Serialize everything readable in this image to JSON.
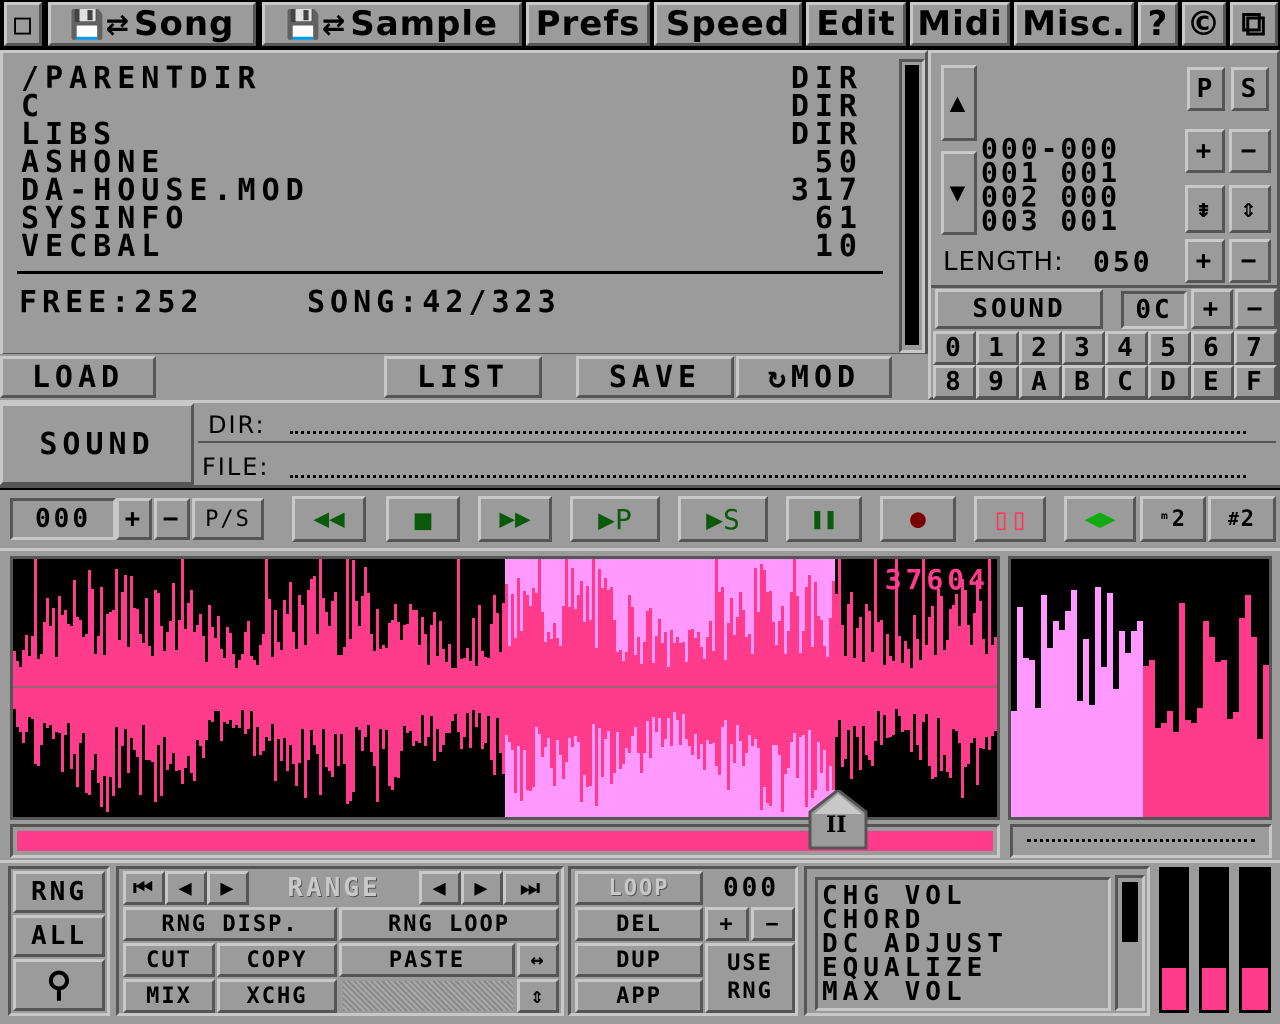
{
  "menu": {
    "close_glyph": "▫",
    "song_label": "Song",
    "sample_label": "Sample",
    "prefs_label": "Prefs",
    "speed_label": "Speed",
    "edit_label": "Edit",
    "midi_label": "Midi",
    "misc_label": "Misc.",
    "help_label": "?",
    "about_label": "©",
    "window_glyph": "⧉"
  },
  "file_browser": {
    "rows": [
      {
        "name": "/PARENTDIR",
        "size": "DIR"
      },
      {
        "name": "C",
        "size": "DIR"
      },
      {
        "name": "LIBS",
        "size": "DIR"
      },
      {
        "name": "ASHONE",
        "size": "50"
      },
      {
        "name": "DA-HOUSE.MOD",
        "size": "317"
      },
      {
        "name": "SYSINFO",
        "size": "61"
      },
      {
        "name": "VECBAL",
        "size": "10"
      }
    ],
    "free_label": "FREE:252",
    "song_label": "SONG:42/323"
  },
  "file_buttons": {
    "load": "LOAD",
    "list": "LIST",
    "save": "SAVE",
    "mod": "↻MOD"
  },
  "path": {
    "mode_label": "SOUND",
    "dir_label": "DIR:",
    "file_label": "FILE:",
    "dir_value": "",
    "file_value": ""
  },
  "pattern": {
    "p_label": "P",
    "s_label": "S",
    "up_glyph": "▲",
    "down_glyph": "▼",
    "rows": [
      "000-000",
      "001 001",
      "002 000",
      "003 001"
    ],
    "plus": "+",
    "minus": "−",
    "length_label": "LENGTH:",
    "length_value": "050",
    "sound_label": "SOUND",
    "sound_value": "0C",
    "hex_row1": [
      "0",
      "1",
      "2",
      "3",
      "4",
      "5",
      "6",
      "7"
    ],
    "hex_row2": [
      "8",
      "9",
      "A",
      "B",
      "C",
      "D",
      "E",
      "F"
    ]
  },
  "transport": {
    "position_value": "000",
    "plus": "+",
    "minus": "−",
    "ps_label": "P/S",
    "rewind_glyph": "◀◀",
    "stop_glyph": "■",
    "ffwd_glyph": "▶▶",
    "play_pattern_label": "▶P",
    "play_song_label": "▶S",
    "pause_glyph": "❚❚",
    "record_glyph": "●",
    "loop_glyph": "▯▯",
    "edit_glyph": "◀▶",
    "tracks_label_a": "2",
    "tracks_label_b": "2"
  },
  "waveform": {
    "sample_length_label": "37604",
    "accent_color": "#ff3b8c",
    "range_color": "#ff99ff",
    "range_start_fraction": 0.5,
    "range_end_fraction": 0.835,
    "scroll_thumb_label": "II"
  },
  "range_panel": {
    "rng_label": "RNG",
    "all_label": "ALL",
    "zoom_glyph": "⚲",
    "first_glyph": "⏮",
    "prev_glyph": "◀",
    "next_glyph": "▶",
    "range_label": "RANGE",
    "prev2_glyph": "◀",
    "next2_glyph": "▶",
    "last_glyph": "⏭",
    "rng_disp_label": "RNG DISP.",
    "rng_loop_label": "RNG LOOP",
    "cut_label": "CUT",
    "copy_label": "COPY",
    "paste_label": "PASTE",
    "swap_glyph": "↔",
    "mix_label": "MIX",
    "xchg_label": "XCHG",
    "updown_glyph": "⇕"
  },
  "loop_panel": {
    "loop_label": "LOOP",
    "loop_value": "000",
    "del_label": "DEL",
    "plus": "+",
    "minus": "−",
    "dup_label": "DUP",
    "use_label": "USE",
    "rng_label": "RNG",
    "app_label": "APP"
  },
  "effects": {
    "items": [
      "CHG VOL",
      "CHORD",
      "DC ADJUST",
      "EQUALIZE",
      "MAX VOL"
    ]
  },
  "meters": {
    "levels": [
      0.3,
      0.3,
      0.3
    ]
  }
}
